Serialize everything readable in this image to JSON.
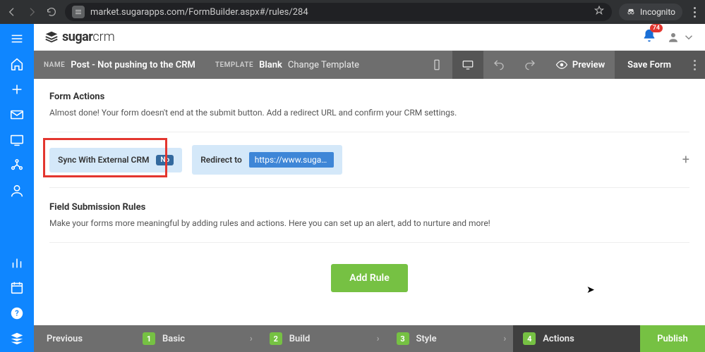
{
  "browser": {
    "url": "market.sugarapps.com/FormBuilder.aspx#/rules/284",
    "incognito_label": "Incognito"
  },
  "brand": {
    "bold": "sugar",
    "thin": "crm"
  },
  "notification_count": "74",
  "subheader": {
    "name_label": "NAME",
    "name_value": "Post - Not pushing to the CRM",
    "template_label": "TEMPLATE",
    "template_value": "Blank",
    "change_template": "Change Template",
    "preview": "Preview",
    "save": "Save Form"
  },
  "form_actions": {
    "title": "Form Actions",
    "desc": "Almost done! Your form doesn't end at the submit button. Add a redirect URL and confirm your CRM settings.",
    "sync_label": "Sync With External CRM",
    "sync_state": "No",
    "redirect_label": "Redirect to",
    "redirect_url": "https://www.sugarcrm.c..."
  },
  "submission_rules": {
    "title": "Field Submission Rules",
    "desc": "Make your forms more meaningful by adding rules and actions. Here you can set up an alert, add to nurture and more!",
    "add_rule": "Add Rule"
  },
  "wizard": {
    "previous": "Previous",
    "steps": [
      {
        "num": "1",
        "label": "Basic"
      },
      {
        "num": "2",
        "label": "Build"
      },
      {
        "num": "3",
        "label": "Style"
      },
      {
        "num": "4",
        "label": "Actions"
      }
    ],
    "publish": "Publish"
  }
}
